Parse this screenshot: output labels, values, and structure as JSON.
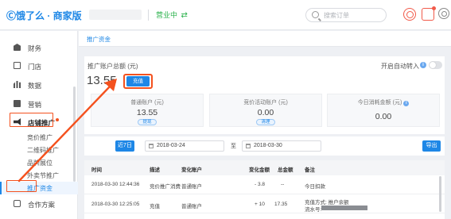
{
  "header": {
    "logo": "Ⓒ饿了么 · 商家版",
    "status_text": "营业中",
    "status_icon": "⇄",
    "search_placeholder": "搜索订单",
    "icons": [
      "help-icon",
      "message-icon",
      "settings-icon"
    ]
  },
  "sidebar": {
    "items": [
      {
        "label": "财务",
        "icon": "wallet-icon"
      },
      {
        "label": "门店",
        "icon": "store-icon"
      },
      {
        "label": "数据",
        "icon": "bar-chart-icon"
      },
      {
        "label": "营销",
        "icon": "marketing-icon"
      },
      {
        "label": "店铺推广",
        "icon": "megaphone-icon"
      }
    ],
    "sub_items": [
      "竞价推广",
      "二维码推广",
      "品牌展位",
      "外卖节推广",
      "推广资金"
    ],
    "bottom_item": {
      "label": "合作方案",
      "icon": "partner-icon"
    }
  },
  "breadcrumb": "推广资金",
  "account": {
    "title": "推广账户总额 (元)",
    "amount": "13.55",
    "recharge_label": "充值",
    "auto_transfer_label": "开启自动转入",
    "auto_transfer_on": false
  },
  "sub_accounts": [
    {
      "title": "普通账户 (元)",
      "value": "13.55",
      "button": "提现"
    },
    {
      "title": "竞价活动账户 (元)",
      "value": "0.00",
      "button": "清理"
    },
    {
      "title": "今日消耗金额 (元)",
      "value": "0.00",
      "info_icon": "info-icon"
    }
  ],
  "filter": {
    "days_label": "近7日",
    "start_date": "2018-03-24",
    "separator": "至",
    "end_date": "2018-03-30",
    "export_label": "导出"
  },
  "table": {
    "columns": [
      "时间",
      "描述",
      "变化账户",
      "变化金额",
      "总金额",
      "备注"
    ],
    "rows": [
      {
        "time": "2018-03-30 12:44:36",
        "desc": "竞价推广消费",
        "account": "普通账户",
        "change": "- 3.8",
        "total": "--",
        "note": "今日扣款",
        "note2": ""
      },
      {
        "time": "2018-03-30 12:25:05",
        "desc": "充值",
        "account": "普通账户",
        "change": "+ 10",
        "total": "17.35",
        "note": "充值方式: 推户余额",
        "note2": "流水号:"
      }
    ]
  },
  "colors": {
    "accent": "#1e87e6",
    "annotation": "#f4511e",
    "online": "#2bb24c"
  }
}
